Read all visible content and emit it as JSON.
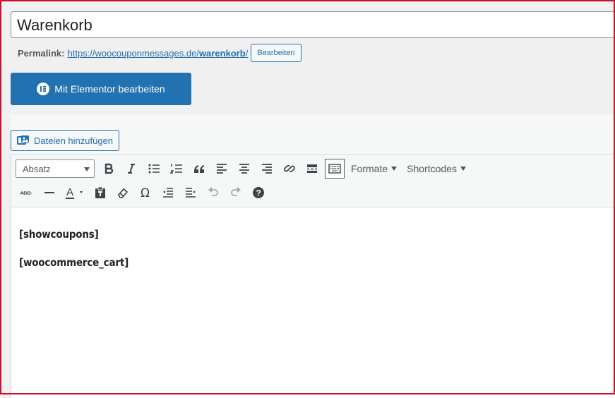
{
  "post": {
    "title": "Warenkorb"
  },
  "permalink": {
    "label": "Permalink:",
    "url_prefix": "https://woocouponmessages.de/",
    "slug": "warenkorb",
    "url_suffix": "/",
    "edit_label": "Bearbeiten"
  },
  "elementor": {
    "label": "Mit Elementor bearbeiten"
  },
  "media": {
    "label": "Dateien hinzufügen"
  },
  "toolbar": {
    "format_select": "Absatz",
    "formats_menu": "Formate",
    "shortcodes_menu": "Shortcodes"
  },
  "content": {
    "lines": [
      "[showcoupons]",
      "[woocommerce_cart]"
    ]
  },
  "colors": {
    "accent": "#2271b1",
    "frame": "#c8102e"
  }
}
